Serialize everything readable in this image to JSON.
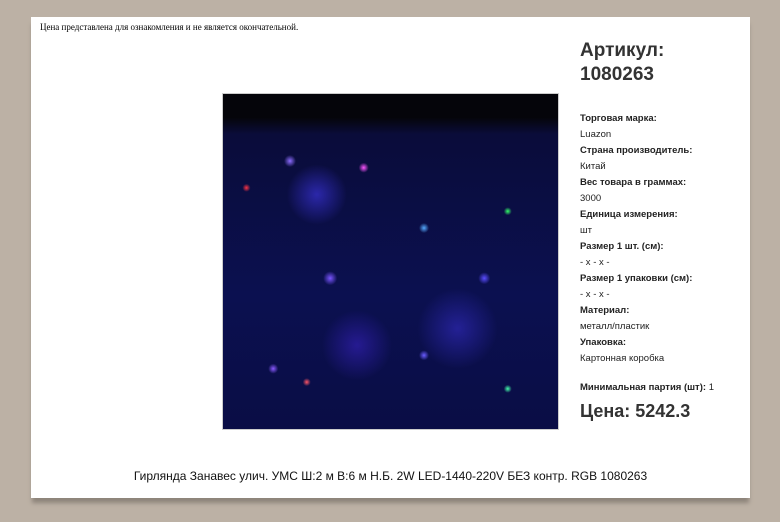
{
  "notice": "Цена представлена для ознакомления и не является окончательной.",
  "sku_label": "Артикул:",
  "sku": "1080263",
  "properties": [
    {
      "label": "Торговая марка:",
      "value": "Luazon"
    },
    {
      "label": "Страна производитель:",
      "value": "Китай"
    },
    {
      "label": "Вес товара в граммах:",
      "value": "3000"
    },
    {
      "label": "Единица измерения:",
      "value": "шт"
    },
    {
      "label": "Размер 1 шт. (см):",
      "value": "- x - x -"
    },
    {
      "label": "Размер 1 упаковки (см):",
      "value": "- x - x -"
    },
    {
      "label": "Материал:",
      "value": "металл/пластик"
    },
    {
      "label": "Упаковка:",
      "value": "Картонная коробка"
    }
  ],
  "min_batch_label": "Минимальная партия (шт):",
  "min_batch": "1",
  "price": "Цена: 5242.3",
  "product_title": "Гирлянда Занавес улич. УМС Ш:2 м В:6 м Н.Б. 2W LED-1440-220V БЕЗ контр. RGB 1080263"
}
